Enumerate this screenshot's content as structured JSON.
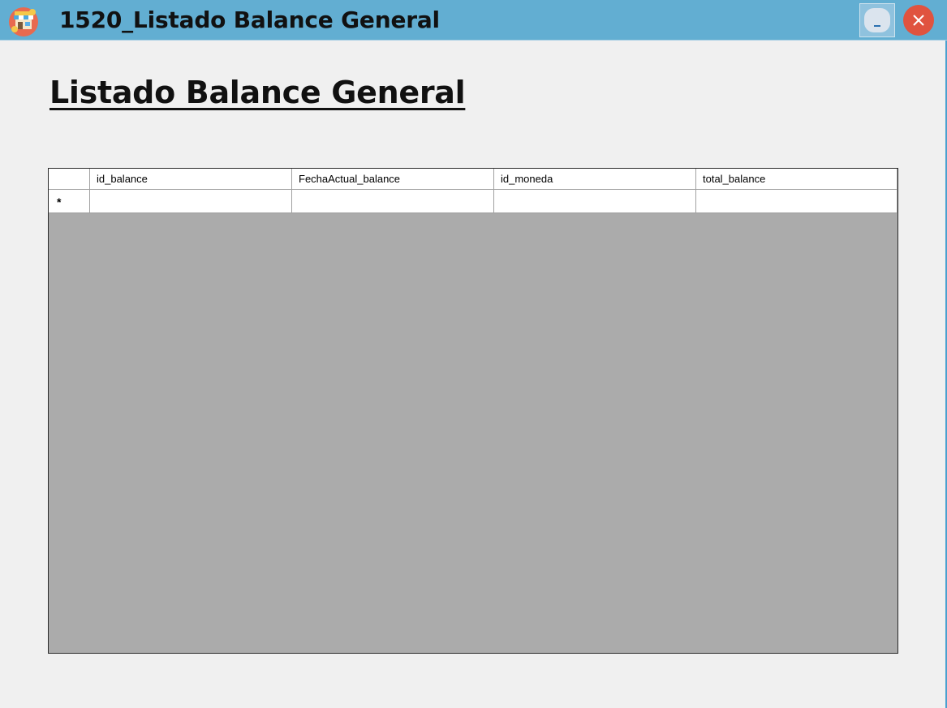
{
  "window": {
    "title": "1520_Listado Balance General",
    "app_icon": "store-icon",
    "controls": {
      "minimize_icon": "minimize-icon",
      "close_icon": "close-icon"
    }
  },
  "main": {
    "heading": "Listado Balance General"
  },
  "grid": {
    "columns": [
      "id_balance",
      "FechaActual_balance",
      "id_moneda",
      "total_balance"
    ],
    "new_row_marker": "*",
    "rows": [
      [
        "",
        "",
        "",
        ""
      ]
    ],
    "empty_area_color": "#ababab"
  },
  "colors": {
    "titlebar": "#62aed2",
    "close_button": "#e0533f",
    "background": "#f0f0f0"
  }
}
